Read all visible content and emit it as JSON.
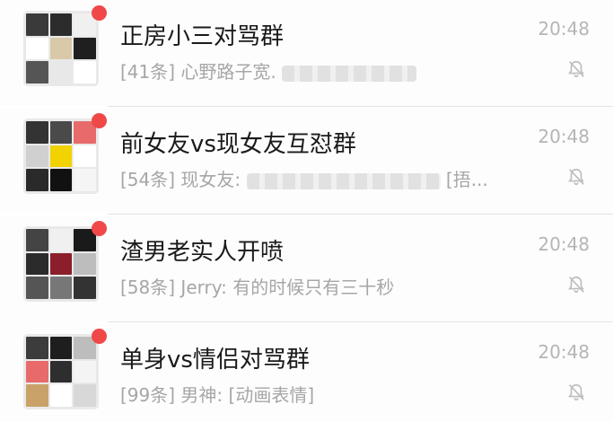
{
  "chats": [
    {
      "title": "正房小三对骂群",
      "time": "20:48",
      "count": "[41条]",
      "sender": "心野路子宽.",
      "message": "",
      "suffix": "",
      "avatar_colors": [
        "#3a3a3a",
        "#2c2c2c",
        "#f0f0f0",
        "#ffffff",
        "#d9c9a8",
        "#1f1f1f",
        "#555555",
        "#e8e8e8",
        "#ffffff"
      ]
    },
    {
      "title": "前女友vs现女友互怼群",
      "time": "20:48",
      "count": "[54条]",
      "sender": "现女友:",
      "message": "",
      "suffix": "[捂...",
      "avatar_colors": [
        "#333333",
        "#4a4a4a",
        "#e86a6a",
        "#d0d0d0",
        "#f2d200",
        "#ffffff",
        "#2a2a2a",
        "#111111",
        "#f5f5f5"
      ]
    },
    {
      "title": "渣男老实人开喷",
      "time": "20:48",
      "count": "[58条]",
      "sender": "Jerry:",
      "message": "有的时候只有三十秒",
      "suffix": "",
      "avatar_colors": [
        "#444444",
        "#f0f0f0",
        "#1a1a1a",
        "#2b2b2b",
        "#8b1e2a",
        "#bdbdbd",
        "#555555",
        "#777777",
        "#333333"
      ]
    },
    {
      "title": "单身vs情侣对骂群",
      "time": "20:48",
      "count": "[99条]",
      "sender": "男神:",
      "message": "[动画表情]",
      "suffix": "",
      "avatar_colors": [
        "#3c3c3c",
        "#1e1e1e",
        "#bdbdbd",
        "#e86a6a",
        "#2e2e2e",
        "#f4f4f4",
        "#c9a26a",
        "#ffffff",
        "#d8d8d8"
      ]
    }
  ],
  "icons": {
    "mute": "muted-bell-icon",
    "unread": "red-dot"
  },
  "colors": {
    "badge": "#f04848",
    "title": "#1a1a1a",
    "muted_text": "#a6a6a6"
  }
}
